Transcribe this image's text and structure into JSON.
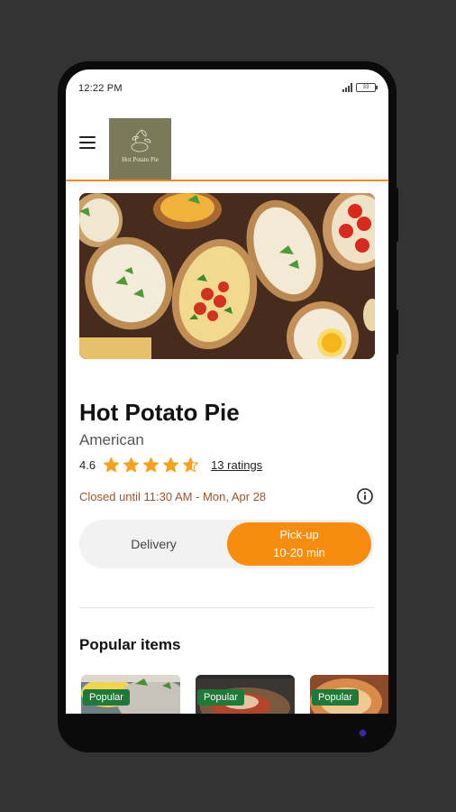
{
  "status_bar": {
    "time": "12:22 PM",
    "battery": "33"
  },
  "header": {
    "logo_text": "Hot Potato Pie"
  },
  "restaurant": {
    "name": "Hot Potato Pie",
    "cuisine": "American",
    "rating": "4.6",
    "rating_value": 4.6,
    "rating_max": 5,
    "ratings_link": "13 ratings",
    "status": "Closed until 11:30 AM - Mon, Apr 28"
  },
  "order_toggle": {
    "delivery_label": "Delivery",
    "pickup_label": "Pick-up",
    "pickup_time": "10-20 min",
    "selected": "pickup"
  },
  "popular": {
    "title": "Popular items",
    "items": [
      {
        "badge": "Popular"
      },
      {
        "badge": "Popular"
      },
      {
        "badge": "Popular"
      }
    ]
  },
  "colors": {
    "accent": "#f88c0e",
    "header_line": "#f28a1b",
    "badge": "#1f7a3a",
    "closed_text": "#a0542a",
    "star": "#f6a21a"
  },
  "icons": {
    "menu": "hamburger-menu-icon",
    "info": "info-icon",
    "star": "star-icon",
    "signal": "signal-icon",
    "battery": "battery-icon"
  }
}
